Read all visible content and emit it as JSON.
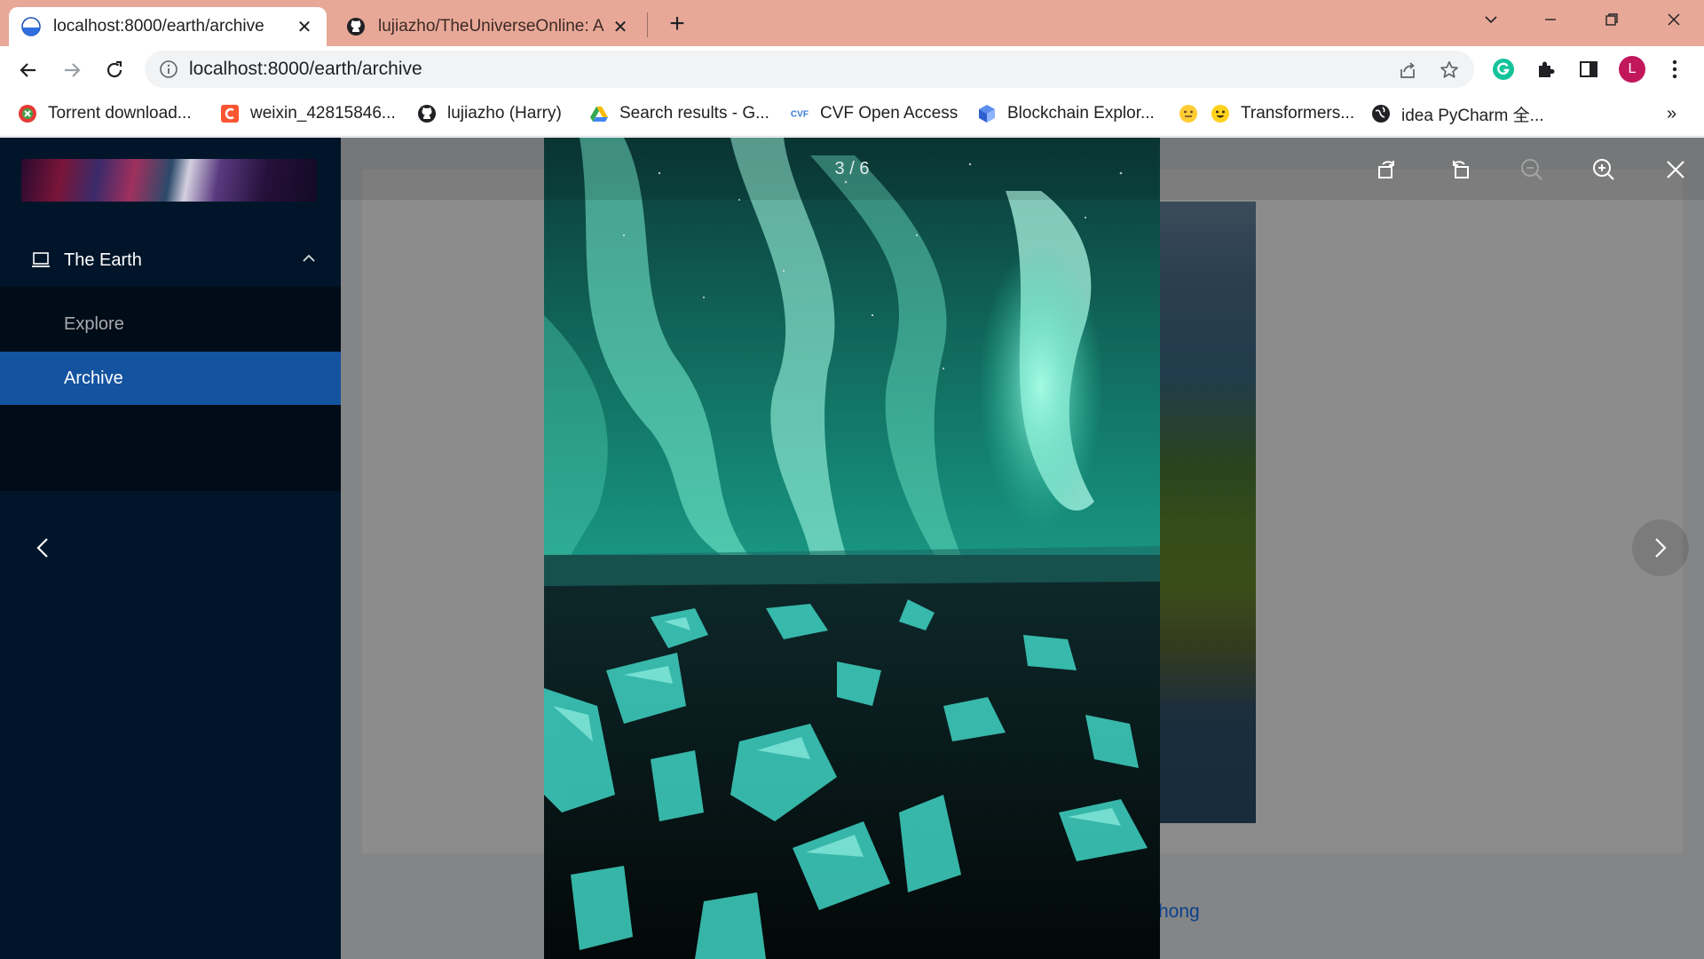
{
  "browser": {
    "tabs": [
      {
        "title": "localhost:8000/earth/archive",
        "active": true
      },
      {
        "title": "lujiazho/TheUniverseOnline: A",
        "active": false
      }
    ],
    "url": "localhost:8000/earth/archive",
    "profile_initial": "L",
    "bookmarks": [
      {
        "label": "Torrent download...",
        "icon": "torrent-icon"
      },
      {
        "label": "weixin_42815846...",
        "icon": "csdn-icon"
      },
      {
        "label": "lujiazho (Harry)",
        "icon": "github-icon"
      },
      {
        "label": "Search results - G...",
        "icon": "google-drive-icon"
      },
      {
        "label": "CVF Open Access",
        "icon": "cvf-icon"
      },
      {
        "label": "Blockchain Explor...",
        "icon": "blockchain-icon"
      },
      {
        "label": "",
        "icon": "emoji-icon"
      },
      {
        "label": "Transformers...",
        "icon": "hugging-face-icon"
      },
      {
        "label": "idea PyCharm 全...",
        "icon": "globe-icon"
      }
    ],
    "bookmarks_overflow": "»"
  },
  "sidebar": {
    "menu_group": {
      "label": "The Earth",
      "icon": "laptop-icon",
      "expanded": true
    },
    "items": [
      {
        "label": "Explore",
        "selected": false
      },
      {
        "label": "Archive",
        "selected": true
      }
    ]
  },
  "content": {
    "author_link": "ia Zhong"
  },
  "preview": {
    "counter": "3 / 6",
    "current_index": 3,
    "total": 6,
    "toolbar_icons": [
      "rotate-left-icon",
      "rotate-right-icon",
      "zoom-out-icon",
      "zoom-in-icon",
      "close-icon"
    ],
    "zoom_out_disabled": true
  },
  "colors": {
    "tab_strip": "#e8a898",
    "sider": "#001529",
    "menu_selected": "#1453a0",
    "link": "#1677ff"
  }
}
